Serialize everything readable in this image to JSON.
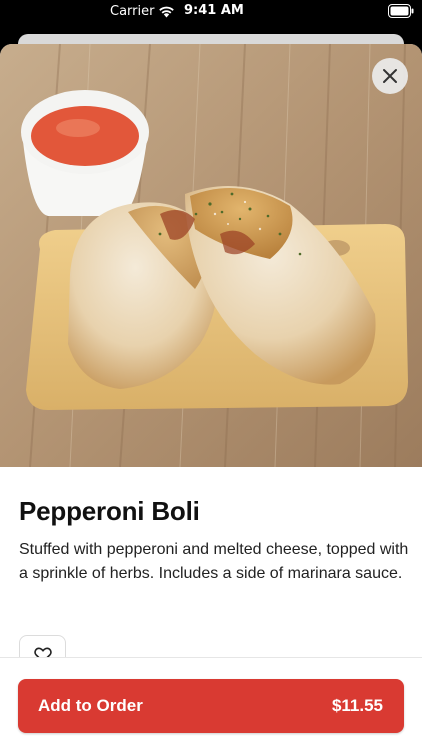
{
  "status_bar": {
    "carrier": "Carrier",
    "time": "9:41 AM"
  },
  "product": {
    "name": "Pepperoni Boli",
    "description": "Stuffed with pepperoni and melted cheese, topped with a sprinkle of herbs. Includes a side of marinara sauce."
  },
  "actions": {
    "add_to_order_label": "Add to Order",
    "price": "$11.55"
  },
  "icons": {
    "close": "close-icon",
    "favorite": "heart-icon",
    "wifi": "wifi-icon",
    "battery": "battery-icon"
  },
  "colors": {
    "primary": "#d93a32",
    "text": "#111111"
  }
}
